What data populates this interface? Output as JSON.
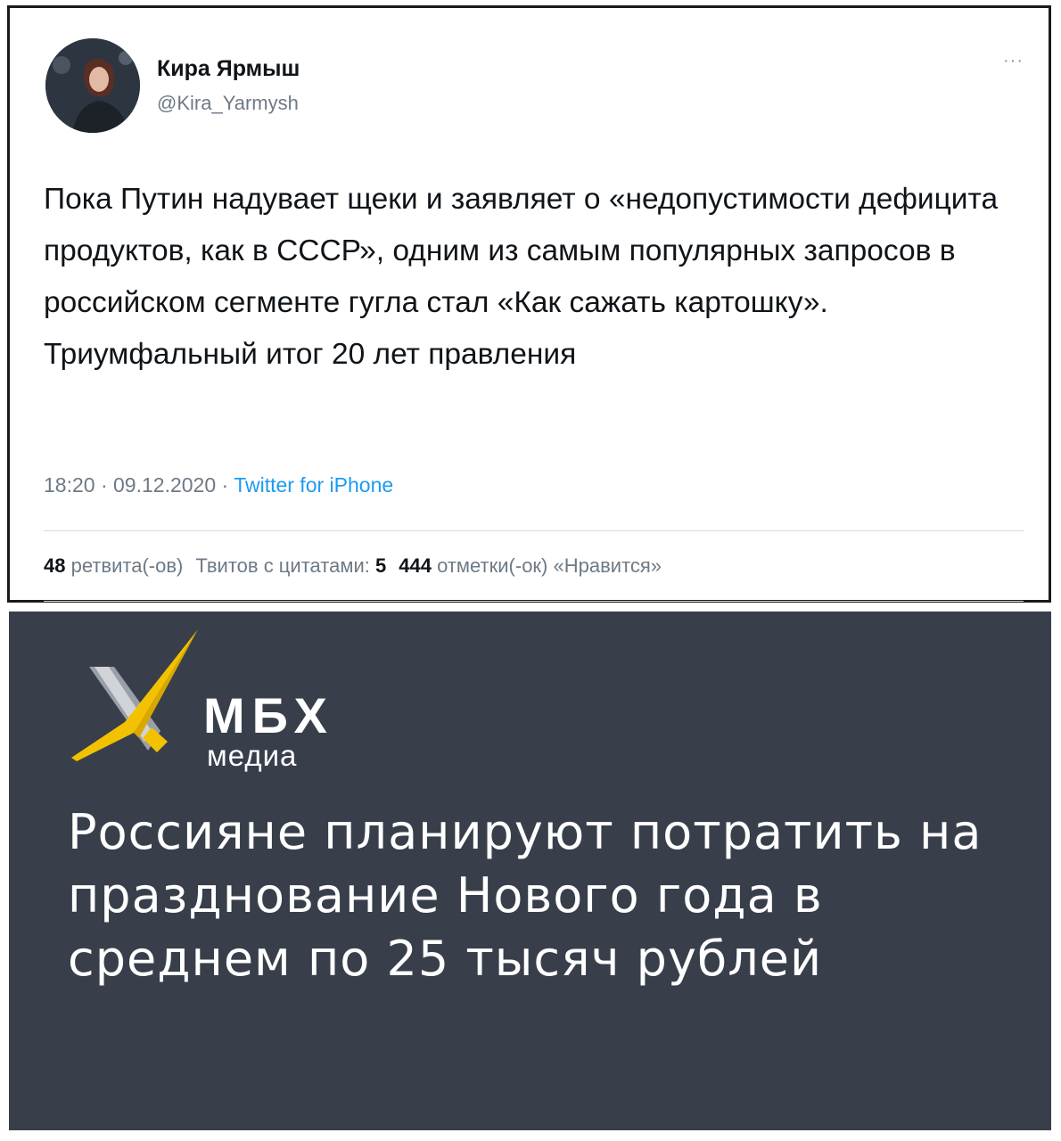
{
  "tweet": {
    "author_name": "Кира Ярмыш",
    "author_handle": "@Kira_Yarmysh",
    "more_icon": "ellipsis-icon",
    "text": "Пока Путин надувает щеки и заявляет о «недопустимости дефицита продуктов, как в СССР», одним из самым популярных запросов в российском сегменте гугла стал «Как сажать картошку». Триумфальный итог 20 лет правления",
    "time": "18:20",
    "separator": "·",
    "date": "09.12.2020",
    "source": "Twitter for iPhone",
    "source_color": "#1d9bf0",
    "stats": {
      "retweets_count": "48",
      "retweets_label": "ретвита(-ов)",
      "quotes_label": "Твитов с цитатами:",
      "quotes_count": "5",
      "likes_count": "444",
      "likes_label": "отметки(-ок) «Нравится»"
    }
  },
  "news": {
    "background": "#383f4b",
    "logo_accent": "#f2c200",
    "brand_name": "МБХ",
    "brand_sub": "медиа",
    "headline": "Россияне планируют потратить на празднование Нового года в среднем по 25 тысяч рублей"
  }
}
